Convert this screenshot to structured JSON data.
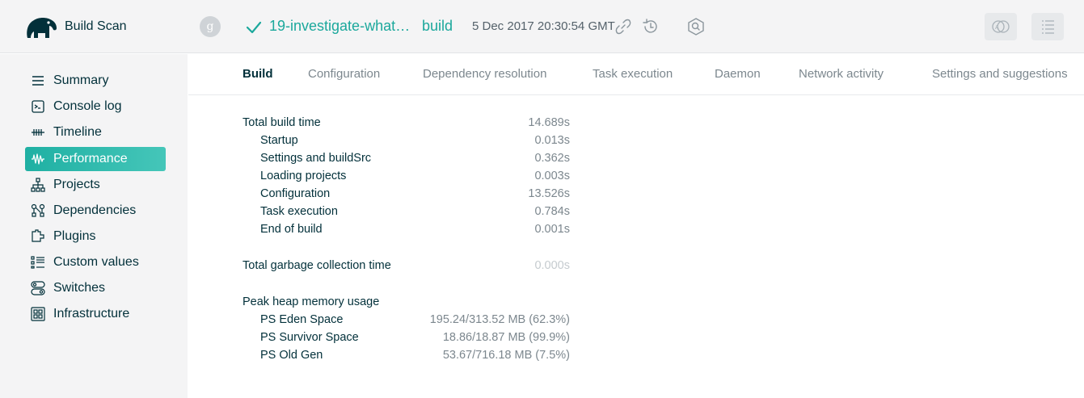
{
  "header": {
    "brand": "Build Scan",
    "avatar_letter": "g",
    "project": "19-investigate-what…",
    "task": "build",
    "timestamp": "5 Dec 2017 20:30:54 GMT"
  },
  "sidebar": {
    "items": [
      {
        "label": "Summary",
        "icon": "summary-icon"
      },
      {
        "label": "Console log",
        "icon": "console-icon"
      },
      {
        "label": "Timeline",
        "icon": "timeline-icon"
      },
      {
        "label": "Performance",
        "icon": "performance-icon",
        "active": true
      },
      {
        "label": "Projects",
        "icon": "projects-icon"
      },
      {
        "label": "Dependencies",
        "icon": "dependencies-icon"
      },
      {
        "label": "Plugins",
        "icon": "plugins-icon"
      },
      {
        "label": "Custom values",
        "icon": "custom-values-icon"
      },
      {
        "label": "Switches",
        "icon": "switches-icon"
      },
      {
        "label": "Infrastructure",
        "icon": "infrastructure-icon"
      }
    ]
  },
  "tabs": [
    {
      "label": "Build",
      "active": true
    },
    {
      "label": "Configuration"
    },
    {
      "label": "Dependency resolution"
    },
    {
      "label": "Task execution"
    },
    {
      "label": "Daemon"
    },
    {
      "label": "Network activity"
    },
    {
      "label": "Settings and suggestions"
    }
  ],
  "build": {
    "total": {
      "label": "Total build time",
      "value": "14.689s"
    },
    "phases": [
      {
        "label": "Startup",
        "value": "0.013s"
      },
      {
        "label": "Settings and buildSrc",
        "value": "0.362s"
      },
      {
        "label": "Loading projects",
        "value": "0.003s"
      },
      {
        "label": "Configuration",
        "value": "13.526s"
      },
      {
        "label": "Task execution",
        "value": "0.784s"
      },
      {
        "label": "End of build",
        "value": "0.001s"
      }
    ],
    "gc": {
      "label": "Total garbage collection time",
      "value": "0.000s"
    },
    "heap": {
      "label": "Peak heap memory usage"
    },
    "heap_rows": [
      {
        "label": "PS Eden Space",
        "value": "195.24/313.52 MB (62.3%)"
      },
      {
        "label": "PS Survivor Space",
        "value": "18.86/18.87 MB (99.9%)"
      },
      {
        "label": "PS Old Gen",
        "value": "53.67/716.18 MB (7.5%)"
      }
    ]
  },
  "colors": {
    "accent": "#1ba89c",
    "active_item": "#2db8ab",
    "text": "#02303a",
    "muted": "#7c878e"
  }
}
